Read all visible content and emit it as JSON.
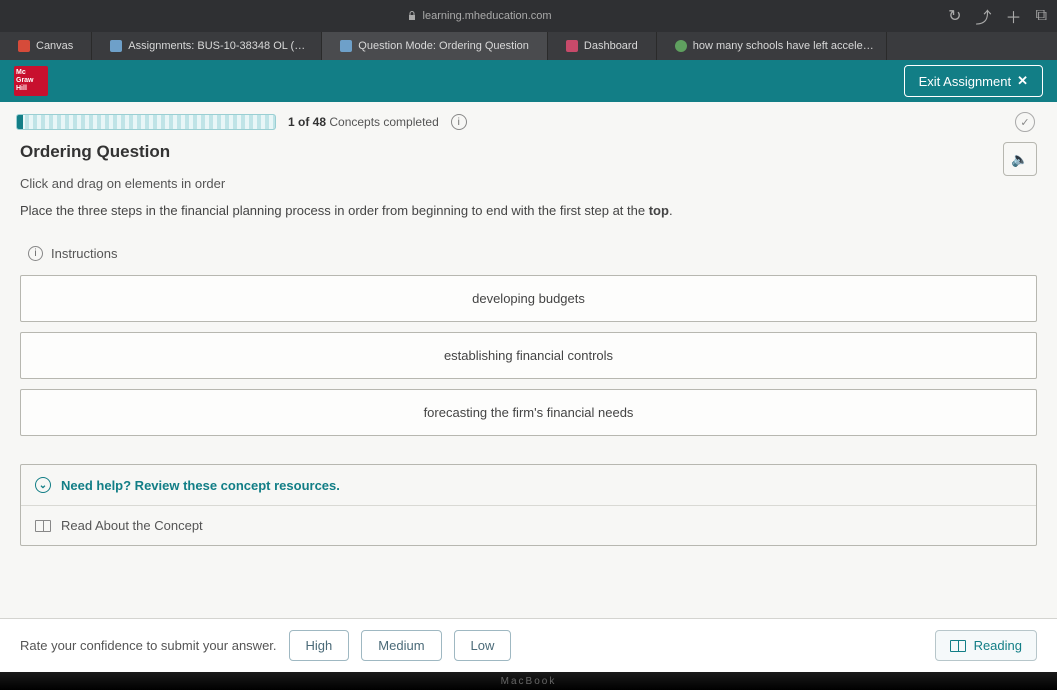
{
  "browser": {
    "url": "learning.mheducation.com",
    "top_right_icons": [
      "refresh",
      "share",
      "plus",
      "tabs"
    ]
  },
  "tabs": [
    {
      "label": "Canvas",
      "favicon": "canvas"
    },
    {
      "label": "Assignments: BUS-10-38348 OL (…",
      "favicon": "generic"
    },
    {
      "label": "Question Mode: Ordering Question",
      "favicon": "generic",
      "active": true
    },
    {
      "label": "Dashboard",
      "favicon": "dash"
    },
    {
      "label": "how many schools have left accele…",
      "favicon": "search"
    }
  ],
  "header": {
    "brand_lines": [
      "Mc",
      "Graw",
      "Hill"
    ],
    "exit_label": "Exit Assignment",
    "exit_glyph": "✕"
  },
  "progress": {
    "completed": 1,
    "total": 48,
    "text_prefix": "1 of 48",
    "text_suffix": " Concepts completed",
    "info_glyph": "i",
    "clock_glyph": "✓"
  },
  "question": {
    "title": "Ordering Question",
    "speaker_glyph": "🔈",
    "subtitle": "Click and drag on elements in order",
    "prompt_pre": "Place the three steps in the financial planning process in order from beginning to end with the first step at the ",
    "prompt_bold": "top",
    "prompt_post": ".",
    "instructions_label": "Instructions",
    "items": [
      "developing budgets",
      "establishing financial controls",
      "forecasting the firm's financial needs"
    ],
    "help_title": "Need help? Review these concept resources.",
    "help_chev": "⌄",
    "read_label": "Read About the Concept"
  },
  "footer": {
    "rate_label": "Rate your confidence to submit your answer.",
    "buttons": [
      "High",
      "Medium",
      "Low"
    ],
    "reading_label": "Reading"
  },
  "bezel": "MacBook"
}
